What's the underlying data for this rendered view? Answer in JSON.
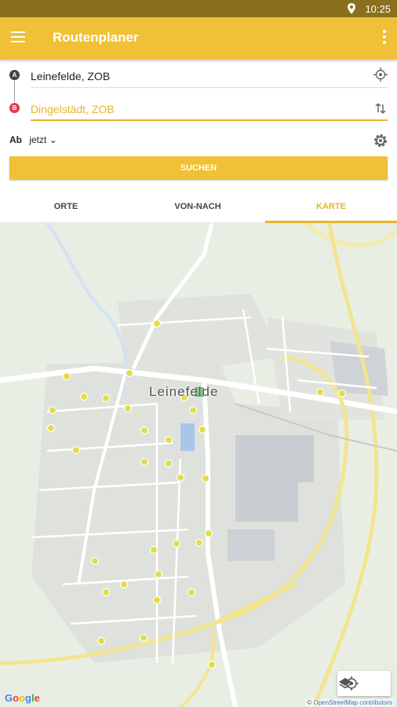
{
  "status": {
    "time": "10:25"
  },
  "appbar": {
    "title": "Routenplaner"
  },
  "form": {
    "from_pin": "A",
    "to_pin": "B",
    "from_value": "Leinefelde, ZOB",
    "to_value": "Dingelstädt, ZOB",
    "time_prefix": "Ab",
    "time_value": "jetzt",
    "search_label": "SUCHEN"
  },
  "tabs": [
    {
      "label": "ORTE",
      "active": false
    },
    {
      "label": "VON-NACH",
      "active": false
    },
    {
      "label": "KARTE",
      "active": true
    }
  ],
  "map": {
    "city_label": "Leinefelde",
    "attribution_prefix": "©",
    "attribution": "OpenStreetMap contributors",
    "logo": "Google"
  },
  "colors": {
    "accent": "#f0c036",
    "status": "#8a6f1c",
    "destination_pin": "#e53950",
    "stop_marker": "#e3dc49"
  }
}
